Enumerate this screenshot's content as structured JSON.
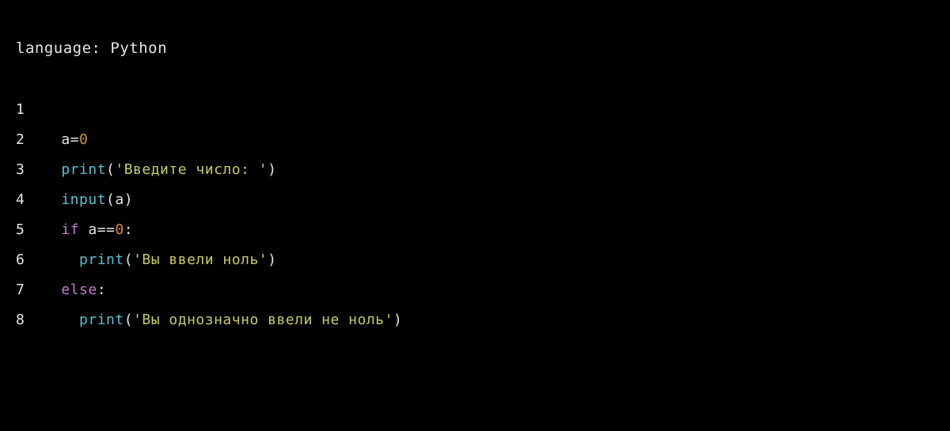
{
  "header": {
    "language_label": "language: ",
    "language_name": "Python"
  },
  "code": {
    "lines": [
      {
        "num": "1",
        "tokens": []
      },
      {
        "num": "2",
        "tokens": [
          {
            "text": "a",
            "cls": "tok-default"
          },
          {
            "text": "=",
            "cls": "tok-op"
          },
          {
            "text": "0",
            "cls": "tok-number"
          }
        ]
      },
      {
        "num": "3",
        "tokens": [
          {
            "text": "print",
            "cls": "tok-func"
          },
          {
            "text": "(",
            "cls": "tok-paren"
          },
          {
            "text": "'Введите число: '",
            "cls": "tok-string"
          },
          {
            "text": ")",
            "cls": "tok-paren"
          }
        ]
      },
      {
        "num": "4",
        "tokens": [
          {
            "text": "input",
            "cls": "tok-func"
          },
          {
            "text": "(a)",
            "cls": "tok-paren"
          }
        ]
      },
      {
        "num": "5",
        "tokens": [
          {
            "text": "if",
            "cls": "tok-keyword"
          },
          {
            "text": " a",
            "cls": "tok-default"
          },
          {
            "text": "==",
            "cls": "tok-op"
          },
          {
            "text": "0",
            "cls": "tok-number"
          },
          {
            "text": ":",
            "cls": "tok-op"
          }
        ]
      },
      {
        "num": "6",
        "tokens": [
          {
            "text": "  ",
            "cls": "tok-default"
          },
          {
            "text": "print",
            "cls": "tok-func"
          },
          {
            "text": "(",
            "cls": "tok-paren"
          },
          {
            "text": "'Вы ввели ноль'",
            "cls": "tok-string"
          },
          {
            "text": ")",
            "cls": "tok-paren"
          }
        ]
      },
      {
        "num": "7",
        "tokens": [
          {
            "text": "else",
            "cls": "tok-keyword"
          },
          {
            "text": ":",
            "cls": "tok-op"
          }
        ]
      },
      {
        "num": "8",
        "tokens": [
          {
            "text": "  ",
            "cls": "tok-default"
          },
          {
            "text": "print",
            "cls": "tok-func"
          },
          {
            "text": "(",
            "cls": "tok-paren"
          },
          {
            "text": "'Вы однозначно ввели не ноль'",
            "cls": "tok-string"
          },
          {
            "text": ")",
            "cls": "tok-paren"
          }
        ]
      }
    ]
  }
}
